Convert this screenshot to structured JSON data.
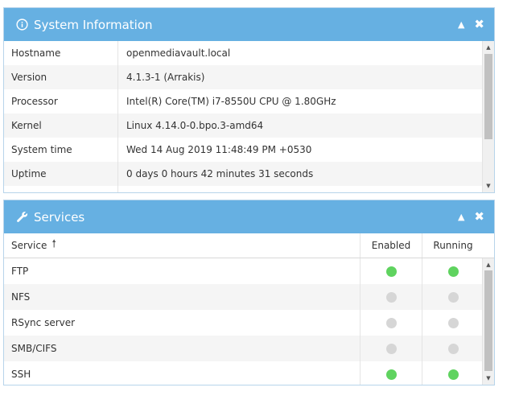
{
  "system_panel": {
    "title": "System Information",
    "rows": [
      {
        "key": "Hostname",
        "value": "openmediavault.local"
      },
      {
        "key": "Version",
        "value": "4.1.3-1 (Arrakis)"
      },
      {
        "key": "Processor",
        "value": "Intel(R) Core(TM) i7-8550U CPU @ 1.80GHz"
      },
      {
        "key": "Kernel",
        "value": "Linux 4.14.0-0.bpo.3-amd64"
      },
      {
        "key": "System time",
        "value": "Wed 14 Aug 2019 11:48:49 PM +0530"
      },
      {
        "key": "Uptime",
        "value": "0 days 0 hours 42 minutes 31 seconds"
      }
    ]
  },
  "services_panel": {
    "title": "Services",
    "columns": {
      "service": "Service",
      "enabled": "Enabled",
      "running": "Running"
    },
    "rows": [
      {
        "name": "FTP",
        "enabled": true,
        "running": true
      },
      {
        "name": "NFS",
        "enabled": false,
        "running": false
      },
      {
        "name": "RSync server",
        "enabled": false,
        "running": false
      },
      {
        "name": "SMB/CIFS",
        "enabled": false,
        "running": false
      },
      {
        "name": "SSH",
        "enabled": true,
        "running": true
      }
    ]
  },
  "colors": {
    "header": "#66b0e2",
    "status_on": "#5fd35f",
    "status_off": "#d6d6d6"
  },
  "icons": {
    "info": "info-circle-icon",
    "wrench": "wrench-icon",
    "collapse": "collapse-up-icon",
    "close": "close-icon",
    "sort": "sort-up-icon"
  }
}
